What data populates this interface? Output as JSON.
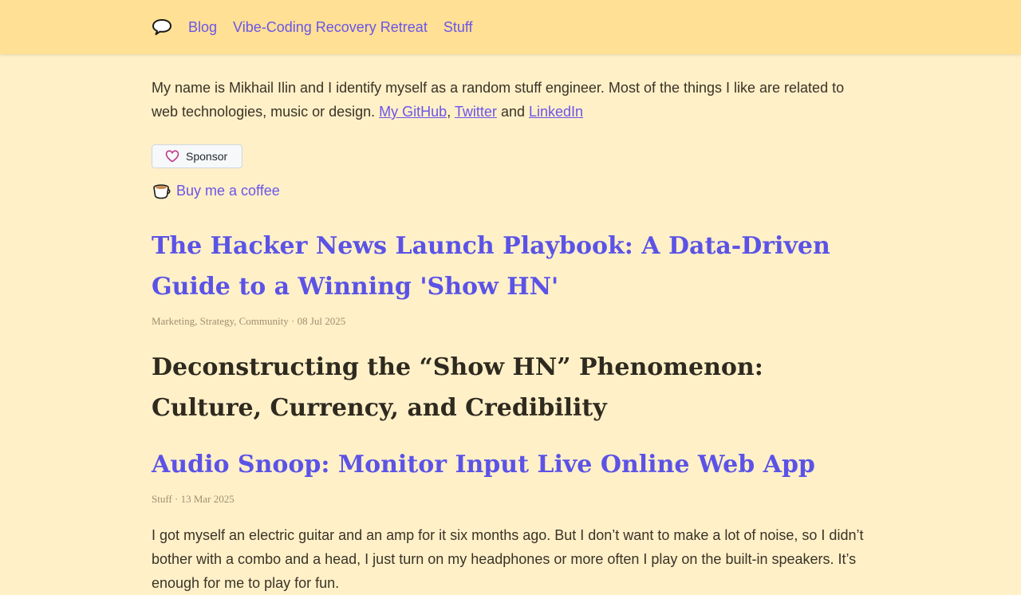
{
  "header": {
    "nav": [
      "Blog",
      "Vibe-Coding Recovery Retreat",
      "Stuff"
    ]
  },
  "intro": {
    "text": "My name is Mikhail Ilin and I identify myself as a random stuff engineer. Most of the things I like are related to web technologies, music or design.",
    "links": [
      "My GitHub",
      "Twitter",
      "LinkedIn"
    ],
    "separator": ",",
    "and": "and"
  },
  "sponsor": {
    "label": "Sponsor"
  },
  "coffee": {
    "label": "Buy me a coffee"
  },
  "posts": [
    {
      "title": "The Hacker News Launch Playbook: A Data-Driven Guide to a Winning 'Show HN'",
      "meta": "Marketing, Strategy, Community · 08 Jul 2025",
      "heading": "Deconstructing the “Show HN” Phenomenon: Culture, Currency, and Credibility"
    },
    {
      "title": "Audio Snoop: Monitor Input Live Online Web App",
      "meta": "Stuff · 13 Mar 2025",
      "excerpt": "I got myself an electric guitar and an amp for it six months ago. But I don’t want to make a lot of noise, so I didn’t bother with a combo and a head, I just turn on my headphones or more often I play on the built-in speakers. It’s enough for me to play for fun."
    }
  ],
  "colors": {
    "accent": "#5b53e6",
    "header_bg": "#ffe095",
    "page_bg": "#fff0c8"
  },
  "icons": [
    "speech-bubble-icon",
    "heart-icon",
    "coffee-cup-icon"
  ]
}
